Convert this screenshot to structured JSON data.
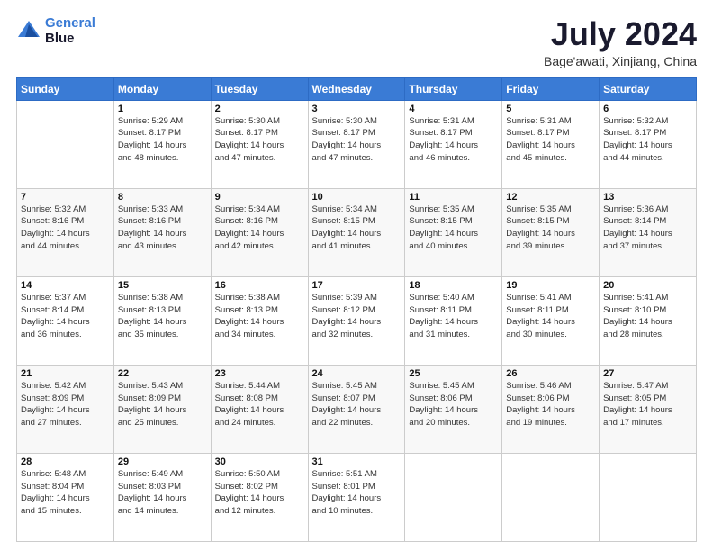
{
  "header": {
    "logo_line1": "General",
    "logo_line2": "Blue",
    "title": "July 2024",
    "subtitle": "Bage'awati, Xinjiang, China"
  },
  "calendar": {
    "weekdays": [
      "Sunday",
      "Monday",
      "Tuesday",
      "Wednesday",
      "Thursday",
      "Friday",
      "Saturday"
    ],
    "weeks": [
      [
        {
          "day": "",
          "info": ""
        },
        {
          "day": "1",
          "info": "Sunrise: 5:29 AM\nSunset: 8:17 PM\nDaylight: 14 hours\nand 48 minutes."
        },
        {
          "day": "2",
          "info": "Sunrise: 5:30 AM\nSunset: 8:17 PM\nDaylight: 14 hours\nand 47 minutes."
        },
        {
          "day": "3",
          "info": "Sunrise: 5:30 AM\nSunset: 8:17 PM\nDaylight: 14 hours\nand 47 minutes."
        },
        {
          "day": "4",
          "info": "Sunrise: 5:31 AM\nSunset: 8:17 PM\nDaylight: 14 hours\nand 46 minutes."
        },
        {
          "day": "5",
          "info": "Sunrise: 5:31 AM\nSunset: 8:17 PM\nDaylight: 14 hours\nand 45 minutes."
        },
        {
          "day": "6",
          "info": "Sunrise: 5:32 AM\nSunset: 8:17 PM\nDaylight: 14 hours\nand 44 minutes."
        }
      ],
      [
        {
          "day": "7",
          "info": "Sunrise: 5:32 AM\nSunset: 8:16 PM\nDaylight: 14 hours\nand 44 minutes."
        },
        {
          "day": "8",
          "info": "Sunrise: 5:33 AM\nSunset: 8:16 PM\nDaylight: 14 hours\nand 43 minutes."
        },
        {
          "day": "9",
          "info": "Sunrise: 5:34 AM\nSunset: 8:16 PM\nDaylight: 14 hours\nand 42 minutes."
        },
        {
          "day": "10",
          "info": "Sunrise: 5:34 AM\nSunset: 8:15 PM\nDaylight: 14 hours\nand 41 minutes."
        },
        {
          "day": "11",
          "info": "Sunrise: 5:35 AM\nSunset: 8:15 PM\nDaylight: 14 hours\nand 40 minutes."
        },
        {
          "day": "12",
          "info": "Sunrise: 5:35 AM\nSunset: 8:15 PM\nDaylight: 14 hours\nand 39 minutes."
        },
        {
          "day": "13",
          "info": "Sunrise: 5:36 AM\nSunset: 8:14 PM\nDaylight: 14 hours\nand 37 minutes."
        }
      ],
      [
        {
          "day": "14",
          "info": "Sunrise: 5:37 AM\nSunset: 8:14 PM\nDaylight: 14 hours\nand 36 minutes."
        },
        {
          "day": "15",
          "info": "Sunrise: 5:38 AM\nSunset: 8:13 PM\nDaylight: 14 hours\nand 35 minutes."
        },
        {
          "day": "16",
          "info": "Sunrise: 5:38 AM\nSunset: 8:13 PM\nDaylight: 14 hours\nand 34 minutes."
        },
        {
          "day": "17",
          "info": "Sunrise: 5:39 AM\nSunset: 8:12 PM\nDaylight: 14 hours\nand 32 minutes."
        },
        {
          "day": "18",
          "info": "Sunrise: 5:40 AM\nSunset: 8:11 PM\nDaylight: 14 hours\nand 31 minutes."
        },
        {
          "day": "19",
          "info": "Sunrise: 5:41 AM\nSunset: 8:11 PM\nDaylight: 14 hours\nand 30 minutes."
        },
        {
          "day": "20",
          "info": "Sunrise: 5:41 AM\nSunset: 8:10 PM\nDaylight: 14 hours\nand 28 minutes."
        }
      ],
      [
        {
          "day": "21",
          "info": "Sunrise: 5:42 AM\nSunset: 8:09 PM\nDaylight: 14 hours\nand 27 minutes."
        },
        {
          "day": "22",
          "info": "Sunrise: 5:43 AM\nSunset: 8:09 PM\nDaylight: 14 hours\nand 25 minutes."
        },
        {
          "day": "23",
          "info": "Sunrise: 5:44 AM\nSunset: 8:08 PM\nDaylight: 14 hours\nand 24 minutes."
        },
        {
          "day": "24",
          "info": "Sunrise: 5:45 AM\nSunset: 8:07 PM\nDaylight: 14 hours\nand 22 minutes."
        },
        {
          "day": "25",
          "info": "Sunrise: 5:45 AM\nSunset: 8:06 PM\nDaylight: 14 hours\nand 20 minutes."
        },
        {
          "day": "26",
          "info": "Sunrise: 5:46 AM\nSunset: 8:06 PM\nDaylight: 14 hours\nand 19 minutes."
        },
        {
          "day": "27",
          "info": "Sunrise: 5:47 AM\nSunset: 8:05 PM\nDaylight: 14 hours\nand 17 minutes."
        }
      ],
      [
        {
          "day": "28",
          "info": "Sunrise: 5:48 AM\nSunset: 8:04 PM\nDaylight: 14 hours\nand 15 minutes."
        },
        {
          "day": "29",
          "info": "Sunrise: 5:49 AM\nSunset: 8:03 PM\nDaylight: 14 hours\nand 14 minutes."
        },
        {
          "day": "30",
          "info": "Sunrise: 5:50 AM\nSunset: 8:02 PM\nDaylight: 14 hours\nand 12 minutes."
        },
        {
          "day": "31",
          "info": "Sunrise: 5:51 AM\nSunset: 8:01 PM\nDaylight: 14 hours\nand 10 minutes."
        },
        {
          "day": "",
          "info": ""
        },
        {
          "day": "",
          "info": ""
        },
        {
          "day": "",
          "info": ""
        }
      ]
    ]
  }
}
